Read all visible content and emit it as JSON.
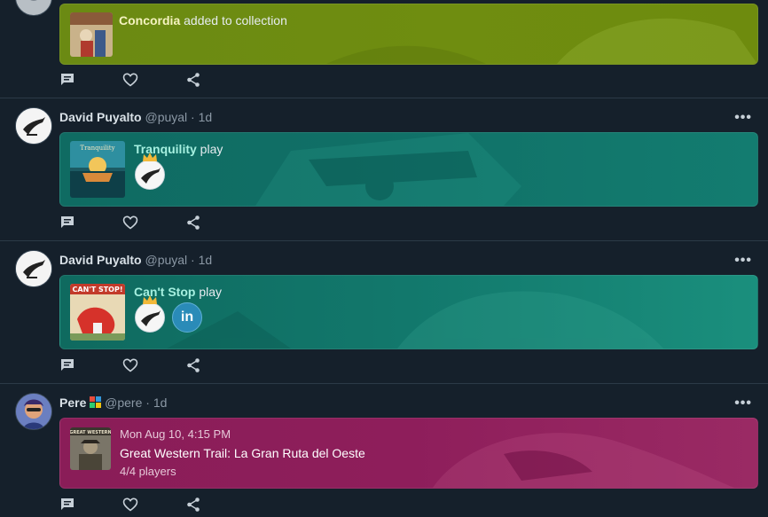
{
  "posts": [
    {
      "card": {
        "game": "Concordia",
        "suffix": " added to collection"
      }
    },
    {
      "author": {
        "name": "David Puyalto",
        "handle": "@puyal",
        "time": "1d"
      },
      "card": {
        "game": "Tranquility",
        "suffix": " play"
      }
    },
    {
      "author": {
        "name": "David Puyalto",
        "handle": "@puyal",
        "time": "1d"
      },
      "card": {
        "game": "Can't Stop",
        "suffix": " play",
        "second_player_initials": "in"
      }
    },
    {
      "author": {
        "name": "Pere",
        "handle": "@pere",
        "time": "1d"
      },
      "card": {
        "date": "Mon Aug 10, 4:15 PM",
        "game": "Great Western Trail: La Gran Ruta del Oeste",
        "players": "4/4 players"
      }
    }
  ],
  "ui": {
    "separator": " · ",
    "more": "•••"
  },
  "colors": {
    "background": "#15202b",
    "card_olive": "#6d8a12",
    "card_teal": "#0f6a63",
    "card_teal2": "#178a7a",
    "card_magenta": "#8c1d5a",
    "linkedin": "#2a8bb8"
  },
  "icons": [
    "comment-icon",
    "heart-icon",
    "share-icon",
    "more-icon",
    "crown-icon"
  ]
}
